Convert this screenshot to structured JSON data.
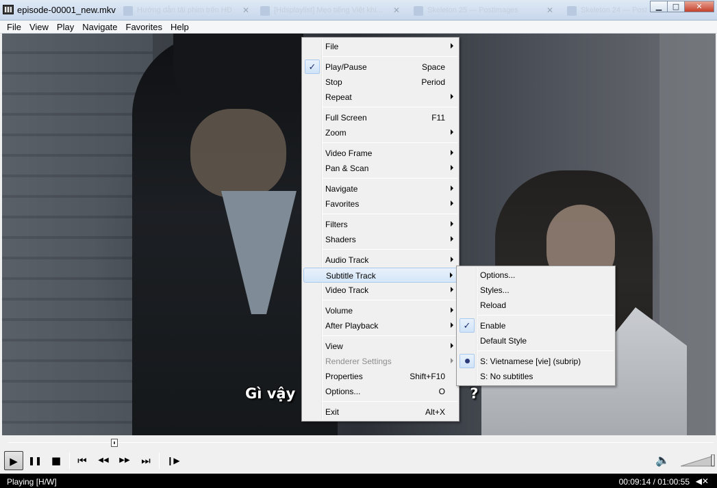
{
  "window": {
    "title": "episode-00001_new.mkv",
    "bg_tabs": [
      "Hướng dẫn tải phim trên HĐ",
      "[Hdsplaylist] Mẹo tiếng Việt khi...",
      "Skeleton 25 — Postimages",
      "Skeleton 24 — Postimages"
    ],
    "controls": {
      "minimize": "▁",
      "maximize": "□",
      "close": "✕"
    }
  },
  "menubar": [
    "File",
    "View",
    "Play",
    "Navigate",
    "Favorites",
    "Help"
  ],
  "video": {
    "subtitle_left": "Gì vậy",
    "subtitle_right": "?"
  },
  "context_menu": {
    "items": [
      {
        "label": "File",
        "submenu": true
      },
      {
        "sep": true
      },
      {
        "label": "Play/Pause",
        "accel": "Space",
        "checked": true
      },
      {
        "label": "Stop",
        "accel": "Period"
      },
      {
        "label": "Repeat",
        "submenu": true
      },
      {
        "sep": true
      },
      {
        "label": "Full Screen",
        "accel": "F11"
      },
      {
        "label": "Zoom",
        "submenu": true
      },
      {
        "sep": true
      },
      {
        "label": "Video Frame",
        "submenu": true
      },
      {
        "label": "Pan & Scan",
        "submenu": true
      },
      {
        "sep": true
      },
      {
        "label": "Navigate",
        "submenu": true
      },
      {
        "label": "Favorites",
        "submenu": true
      },
      {
        "sep": true
      },
      {
        "label": "Filters",
        "submenu": true
      },
      {
        "label": "Shaders",
        "submenu": true
      },
      {
        "sep": true
      },
      {
        "label": "Audio Track",
        "submenu": true
      },
      {
        "label": "Subtitle Track",
        "submenu": true,
        "highlight": true
      },
      {
        "label": "Video Track",
        "submenu": true
      },
      {
        "sep": true
      },
      {
        "label": "Volume",
        "submenu": true
      },
      {
        "label": "After Playback",
        "submenu": true
      },
      {
        "sep": true
      },
      {
        "label": "View",
        "submenu": true
      },
      {
        "label": "Renderer Settings",
        "submenu": true,
        "disabled": true
      },
      {
        "label": "Properties",
        "accel": "Shift+F10"
      },
      {
        "label": "Options...",
        "accel": "O"
      },
      {
        "sep": true
      },
      {
        "label": "Exit",
        "accel": "Alt+X"
      }
    ]
  },
  "subtitle_menu": {
    "items": [
      {
        "label": "Options..."
      },
      {
        "label": "Styles..."
      },
      {
        "label": "Reload"
      },
      {
        "sep": true
      },
      {
        "label": "Enable",
        "checked": true
      },
      {
        "label": "Default Style"
      },
      {
        "sep": true
      },
      {
        "label": "S: Vietnamese [vie] (subrip)",
        "radio": true
      },
      {
        "label": "S: No subtitles"
      }
    ]
  },
  "seek": {
    "position_fraction": 0.15
  },
  "transport": {
    "play": "▶",
    "pause": "❚❚",
    "stop": "■",
    "prev": "⏮",
    "rewind": "◀◀",
    "forward": "▶▶",
    "next": "⏭",
    "frame_step": "❙▶",
    "volume_icon": "🔈"
  },
  "volume": {
    "level_fraction": 1.0
  },
  "status": {
    "text": "Playing [H/W]",
    "time": "00:09:14 / 01:00:55"
  }
}
